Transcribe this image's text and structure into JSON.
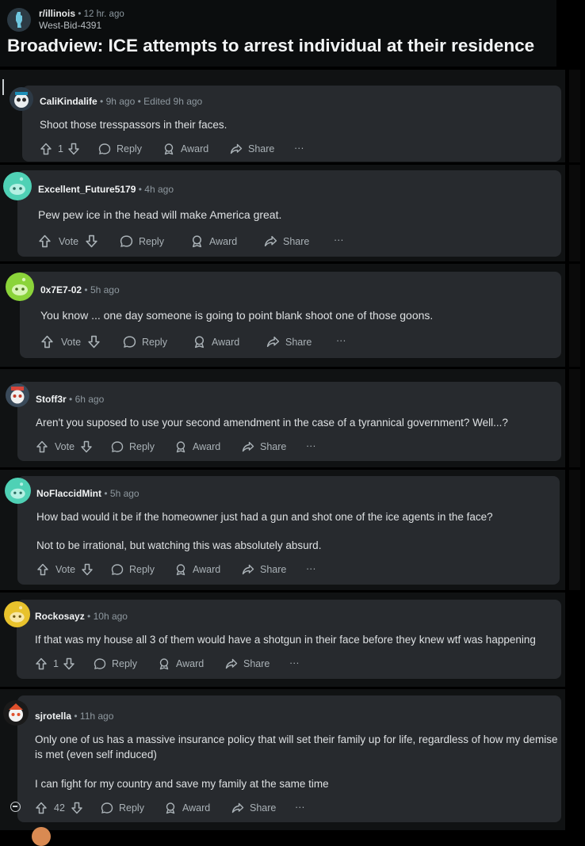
{
  "post": {
    "subreddit": "r/illinois",
    "time": "12 hr. ago",
    "author": "West-Bid-4391",
    "title": "Broadview: ICE attempts to arrest individual at their residence"
  },
  "actions": {
    "vote": "Vote",
    "reply": "Reply",
    "award": "Award",
    "share": "Share",
    "more": "···"
  },
  "comments": [
    {
      "user": "CaliKindalife",
      "time": "9h ago",
      "edited": "Edited 9h ago",
      "votes": "1",
      "lines": [
        "Shoot those tresspassors in their faces."
      ]
    },
    {
      "user": "Excellent_Future5179",
      "time": "4h ago",
      "votes": "Vote",
      "lines": [
        "Pew pew ice in the head will make America great."
      ]
    },
    {
      "user": "0x7E7-02",
      "time": "5h ago",
      "votes": "Vote",
      "lines": [
        "You know ... one day someone is going to point blank shoot one of those goons."
      ]
    },
    {
      "user": "Stoff3r",
      "time": "6h ago",
      "votes": "Vote",
      "lines": [
        "Aren't you suposed to use your second amendment in the case of a tyrannical government? Well...?"
      ]
    },
    {
      "user": "NoFlaccidMint",
      "time": "5h ago",
      "votes": "Vote",
      "lines": [
        "How bad would it be if the homeowner just had a gun and shot one of the ice agents in the face?",
        "Not to be irrational, but watching this was absolutely absurd."
      ]
    },
    {
      "user": "Rockosayz",
      "time": "10h ago",
      "votes": "1",
      "lines": [
        "If that was my house all 3 of them would have a shotgun in their face before they knew wtf was happening"
      ]
    },
    {
      "user": "sjrotella",
      "time": "11h ago",
      "votes": "42",
      "lines": [
        "Only one of us has a massive insurance policy that will set their family up for life, regardless of how my demise",
        "is met (even self induced)",
        "I can fight for my country and save my family at the same time"
      ]
    }
  ],
  "colors": {
    "avatar_teal": "#4fd1b5",
    "avatar_green": "#8bd43a",
    "avatar_yellow": "#e8c22c",
    "card": "#272a2e"
  }
}
